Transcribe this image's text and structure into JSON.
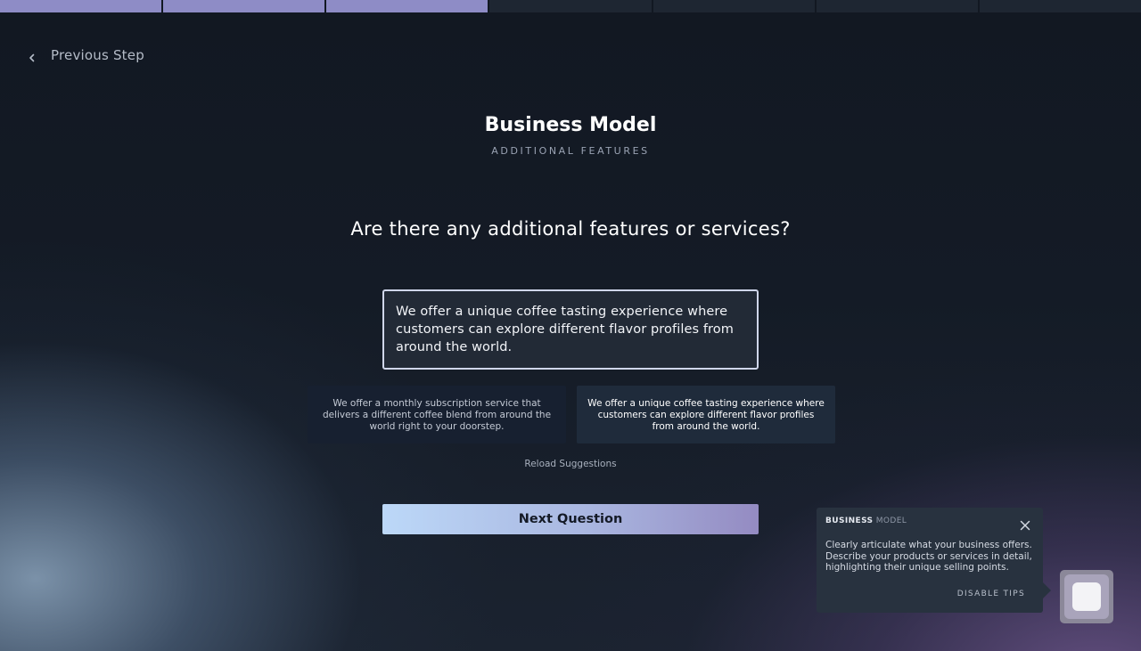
{
  "progress": {
    "total_steps": 7,
    "completed_steps": 3
  },
  "nav": {
    "previous_label": "Previous Step"
  },
  "header": {
    "title": "Business Model",
    "subtitle": "ADDITIONAL FEATURES"
  },
  "question": {
    "text": "Are there any additional features or services?",
    "answer": "We offer a unique coffee tasting experience where customers can explore different flavor profiles from around the world."
  },
  "suggestions": [
    {
      "text": "We offer a monthly subscription service that delivers a different coffee blend from around the world right to your doorstep.",
      "selected": false
    },
    {
      "text": "We offer a unique coffee tasting experience where customers can explore different flavor profiles from around the world.",
      "selected": true
    }
  ],
  "reload_label": "Reload Suggestions",
  "next_label": "Next Question",
  "tip": {
    "heading_strong": "BUSINESS",
    "heading_light": "MODEL",
    "body": "Clearly articulate what your business offers. Describe your products or services in detail, highlighting their unique selling points.",
    "disable_label": "DISABLE TIPS"
  },
  "colors": {
    "progress_done": "#8e8cc6",
    "progress_pending": "#1e2632",
    "accent_start": "#bcd8f8",
    "accent_end": "#948bc2"
  }
}
